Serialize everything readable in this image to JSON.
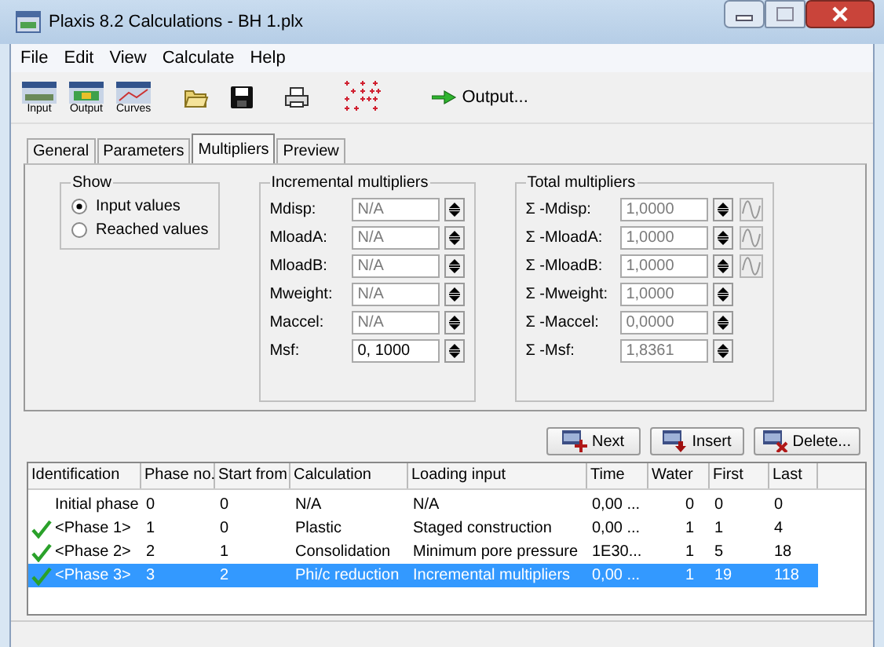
{
  "window": {
    "title": "Plaxis 8.2 Calculations - BH 1.plx"
  },
  "menu": [
    "File",
    "Edit",
    "View",
    "Calculate",
    "Help"
  ],
  "toolbar": {
    "program_buttons": [
      {
        "label": "Input"
      },
      {
        "label": "Output"
      },
      {
        "label": "Curves"
      }
    ],
    "output_button": "Output..."
  },
  "tabs": [
    {
      "label": "General",
      "selected": false
    },
    {
      "label": "Parameters",
      "selected": false
    },
    {
      "label": "Multipliers",
      "selected": true
    },
    {
      "label": "Preview",
      "selected": false
    }
  ],
  "show": {
    "title": "Show",
    "options": [
      {
        "label": "Input values",
        "selected": true
      },
      {
        "label": "Reached values",
        "selected": false
      }
    ]
  },
  "incremental": {
    "title": "Incremental multipliers",
    "rows": [
      {
        "label": "Mdisp:",
        "value": "N/A",
        "disabled": true
      },
      {
        "label": "MloadA:",
        "value": "N/A",
        "disabled": true
      },
      {
        "label": "MloadB:",
        "value": "N/A",
        "disabled": true
      },
      {
        "label": "Mweight:",
        "value": "N/A",
        "disabled": true
      },
      {
        "label": "Maccel:",
        "value": "N/A",
        "disabled": true
      },
      {
        "label": "Msf:",
        "value": "0, 1000",
        "disabled": false
      }
    ]
  },
  "total": {
    "title": "Total multipliers",
    "rows": [
      {
        "label": "Σ -Mdisp:",
        "value": "1,0000",
        "curve_button": true
      },
      {
        "label": "Σ -MloadA:",
        "value": "1,0000",
        "curve_button": true
      },
      {
        "label": "Σ -MloadB:",
        "value": "1,0000",
        "curve_button": true
      },
      {
        "label": "Σ -Mweight:",
        "value": "1,0000",
        "curve_button": false
      },
      {
        "label": "Σ -Maccel:",
        "value": "0,0000",
        "curve_button": false
      },
      {
        "label": "Σ -Msf:",
        "value": "1,8361",
        "curve_button": false
      }
    ]
  },
  "actions": [
    {
      "kind": "next",
      "label": "Next"
    },
    {
      "kind": "insert",
      "label": "Insert"
    },
    {
      "kind": "delete",
      "label": "Delete..."
    }
  ],
  "table": {
    "columns": [
      "Identification",
      "Phase no.",
      "Start from",
      "Calculation",
      "Loading input",
      "Time",
      "Water",
      "First",
      "Last"
    ],
    "rows": [
      {
        "done": false,
        "selected": false,
        "cells": [
          "Initial phase",
          "0",
          "0",
          "N/A",
          "N/A",
          "0,00 ...",
          "0",
          "0",
          "0"
        ]
      },
      {
        "done": true,
        "selected": false,
        "cells": [
          "<Phase 1>",
          "1",
          "0",
          "Plastic",
          "Staged construction",
          "0,00 ...",
          "1",
          "1",
          "4"
        ]
      },
      {
        "done": true,
        "selected": false,
        "cells": [
          "<Phase 2>",
          "2",
          "1",
          "Consolidation",
          "Minimum pore pressure",
          "1E30...",
          "1",
          "5",
          "18"
        ]
      },
      {
        "done": true,
        "selected": true,
        "cells": [
          "<Phase 3>",
          "3",
          "2",
          "Phi/c reduction",
          "Incremental multipliers",
          "0,00 ...",
          "1",
          "19",
          "118"
        ]
      }
    ]
  }
}
